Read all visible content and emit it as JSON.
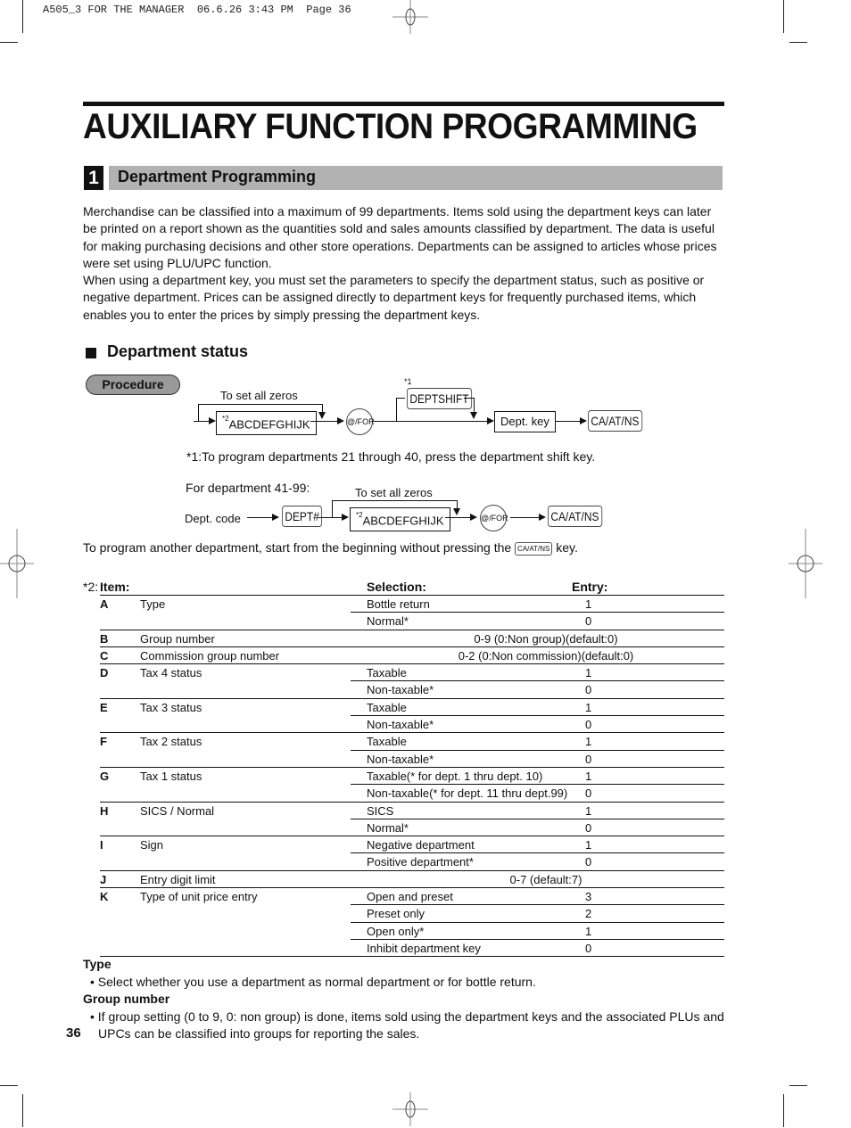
{
  "print_slug": "A505_3 FOR THE MANAGER  06.6.26 3:43 PM  Page 36",
  "page_title": "AUXILIARY FUNCTION PROGRAMMING",
  "section": {
    "number": "1",
    "title": "Department Programming"
  },
  "intro_paragraphs": [
    "Merchandise can be classified into a maximum of 99 departments.  Items sold using the department keys can later be printed on a report shown as the quantities sold and sales amounts classified by department.  The data is useful for making purchasing decisions and other store operations.  Departments can be assigned to articles whose prices were set using PLU/UPC function.",
    "When using a department key, you must set the parameters to specify the department status, such as positive or negative department.  Prices can be assigned directly to department keys for frequently purchased items, which enables you to enter the prices by simply pressing the department keys."
  ],
  "subsection_title": "Department status",
  "procedure_label": "Procedure",
  "diagram1": {
    "zeros_label": "To set all zeros",
    "params_sup": "*2",
    "params_box": "ABCDEFGHIJK",
    "for_key": "@/FOR",
    "shift_note": "*1",
    "shift_key": "DEPTSHIFT",
    "dept_key_box": "Dept. key",
    "finish_key": "CA/AT/NS"
  },
  "footnote1": "*1:To program departments 21 through 40, press the department shift key.",
  "diagram2": {
    "heading": "For department 41-99:",
    "zeros_label": "To set all zeros",
    "dept_code_label": "Dept. code",
    "dept_num_key": "DEPT#",
    "params_sup": "*2",
    "params_box": "ABCDEFGHIJK",
    "for_key": "@/FOR",
    "finish_key": "CA/AT/NS"
  },
  "repeat_note": {
    "before": "To program another department, start from the beginning without pressing the ",
    "key": "CA/AT/NS",
    "after": " key."
  },
  "table": {
    "prefix": "*2:",
    "headers": {
      "item": "Item:",
      "selection": "Selection:",
      "entry": "Entry:"
    },
    "groups": [
      {
        "letter": "A",
        "name": "Type",
        "rows": [
          {
            "selection": "Bottle return",
            "entry": "1"
          },
          {
            "selection": "Normal*",
            "entry": "0"
          }
        ]
      },
      {
        "letter": "B",
        "name": "Group number",
        "range": "0-9 (0:Non group)(default:0)"
      },
      {
        "letter": "C",
        "name": "Commission group number",
        "range": "0-2 (0:Non commission)(default:0)"
      },
      {
        "letter": "D",
        "name": "Tax 4 status",
        "rows": [
          {
            "selection": "Taxable",
            "entry": "1"
          },
          {
            "selection": "Non-taxable*",
            "entry": "0"
          }
        ]
      },
      {
        "letter": "E",
        "name": "Tax 3 status",
        "rows": [
          {
            "selection": "Taxable",
            "entry": "1"
          },
          {
            "selection": "Non-taxable*",
            "entry": "0"
          }
        ]
      },
      {
        "letter": "F",
        "name": "Tax 2 status",
        "rows": [
          {
            "selection": "Taxable",
            "entry": "1"
          },
          {
            "selection": "Non-taxable*",
            "entry": "0"
          }
        ]
      },
      {
        "letter": "G",
        "name": "Tax 1 status",
        "rows": [
          {
            "selection": "Taxable(* for dept. 1 thru dept. 10)",
            "entry": "1"
          },
          {
            "selection": "Non-taxable(* for dept. 11 thru dept.99)",
            "entry": "0"
          }
        ]
      },
      {
        "letter": "H",
        "name": "SICS / Normal",
        "rows": [
          {
            "selection": "SICS",
            "entry": "1"
          },
          {
            "selection": "Normal*",
            "entry": "0"
          }
        ]
      },
      {
        "letter": "I",
        "name": "Sign",
        "rows": [
          {
            "selection": "Negative department",
            "entry": "1"
          },
          {
            "selection": "Positive department*",
            "entry": "0"
          }
        ]
      },
      {
        "letter": "J",
        "name": "Entry digit limit",
        "range": "0-7 (default:7)"
      },
      {
        "letter": "K",
        "name": "Type of unit price entry",
        "rows": [
          {
            "selection": "Open and preset",
            "entry": "3"
          },
          {
            "selection": "Preset only",
            "entry": "2"
          },
          {
            "selection": "Open only*",
            "entry": "1"
          },
          {
            "selection": "Inhibit department key",
            "entry": "0"
          }
        ]
      }
    ]
  },
  "notes": [
    {
      "heading": "Type",
      "bullets": [
        "Select whether you use a department as normal department or for bottle return."
      ]
    },
    {
      "heading": "Group number",
      "bullets": [
        "If group setting (0 to 9, 0: non group) is done, items sold using the department keys and the associated PLUs and UPCs can be classified into groups for reporting the sales."
      ]
    }
  ],
  "page_number": "36"
}
